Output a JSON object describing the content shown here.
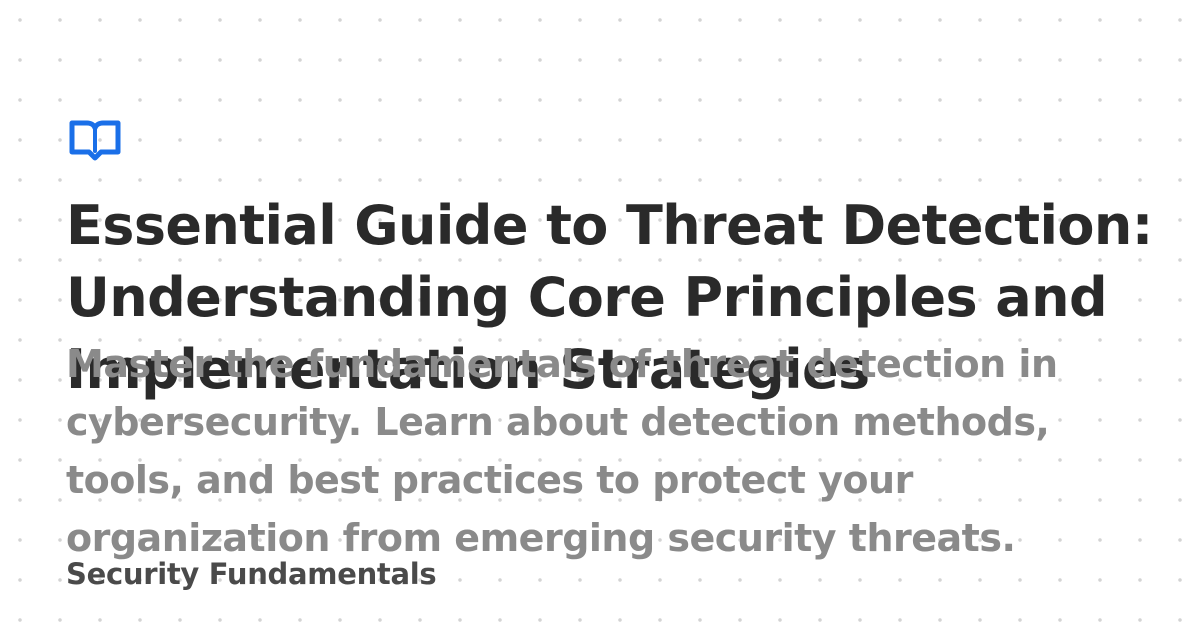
{
  "brand": {
    "icon": "book-open-icon",
    "color": "#1a6fe8"
  },
  "title_lines": [
    "Essential Guide to Threat Detection:",
    "Understanding Core Principles and",
    "Implementation Strategies"
  ],
  "description_lines": [
    "Master the fundamentals of threat detection in",
    "cybersecurity. Learn about detection methods,",
    "tools, and best practices to protect your",
    "organization from emerging security threats."
  ],
  "category": "Security Fundamentals",
  "colors": {
    "title": "#2a2a2a",
    "description": "#8a8a8a",
    "category": "#4a4a4a",
    "dots": "#d4d4d4",
    "background": "#ffffff"
  }
}
